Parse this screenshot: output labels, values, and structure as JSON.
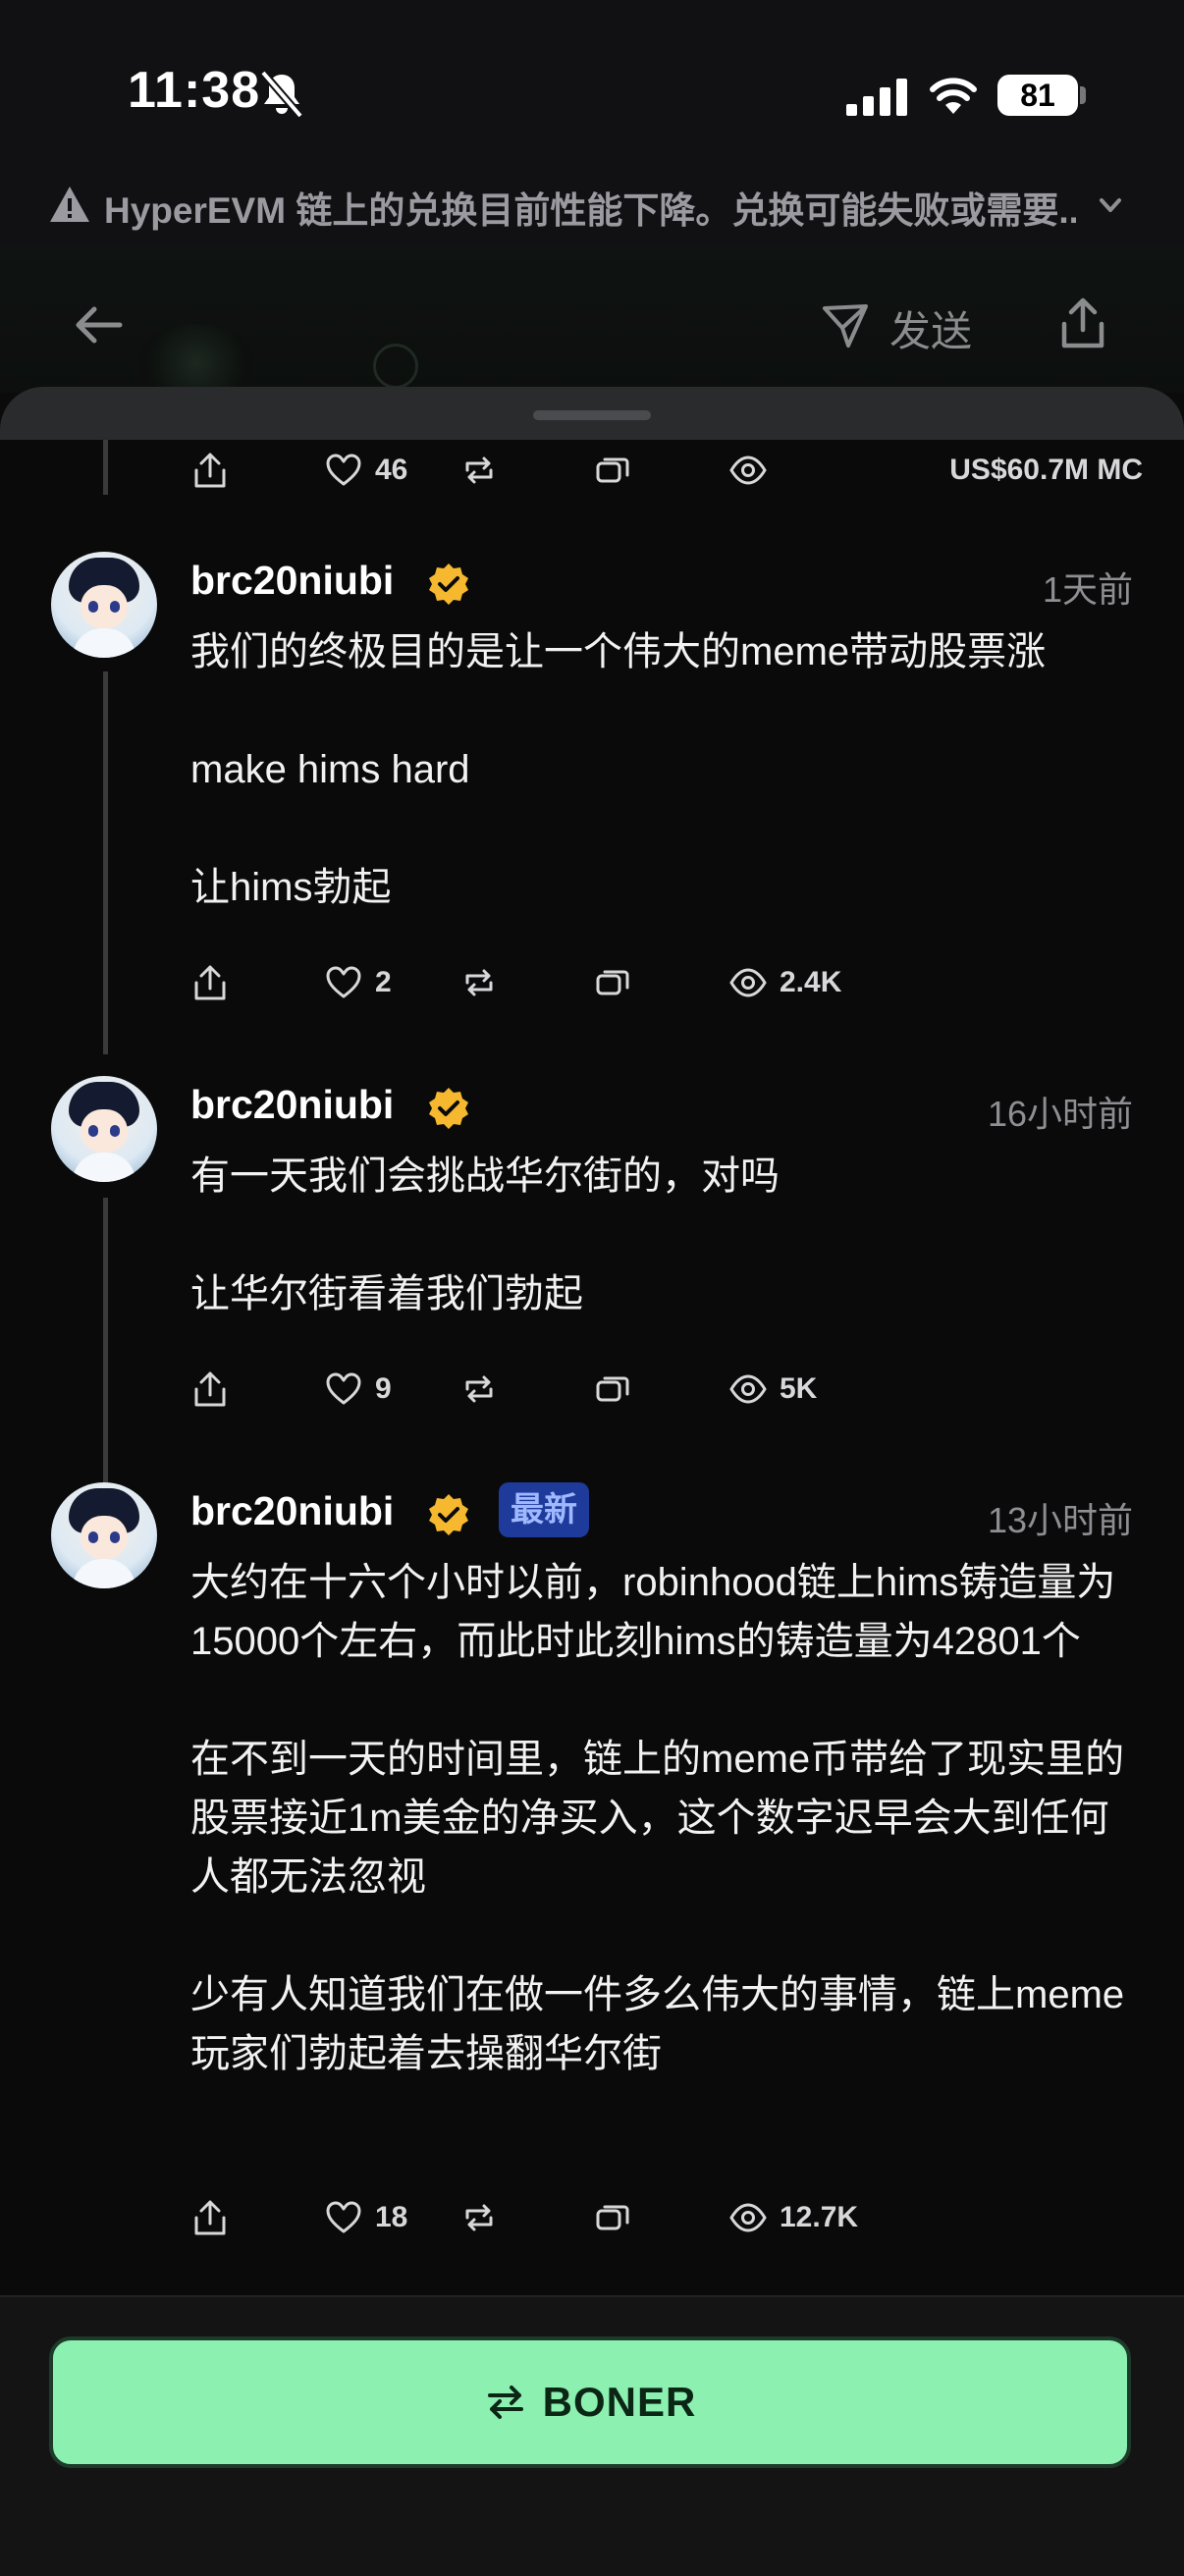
{
  "status_bar": {
    "time": "11:38",
    "battery": "81"
  },
  "warning": {
    "text": "HyperEVM 链上的兑换目前性能下降。兑换可能失败或需要..."
  },
  "header": {
    "send_label": "发送"
  },
  "top_actions": {
    "likes": "46",
    "market_cap": "US$60.7M MC"
  },
  "posts": [
    {
      "username": "brc20niubi",
      "time": "1天前",
      "paragraphs": [
        "我们的终极目的是让一个伟大的meme带动股票涨",
        "make hims hard",
        "让hims勃起"
      ],
      "likes": "2",
      "views": "2.4K"
    },
    {
      "username": "brc20niubi",
      "time": "16小时前",
      "paragraphs": [
        "有一天我们会挑战华尔街的，对吗",
        "让华尔街看着我们勃起"
      ],
      "likes": "9",
      "views": "5K"
    },
    {
      "username": "brc20niubi",
      "tag": "最新",
      "time": "13小时前",
      "paragraphs": [
        "大约在十六个小时以前，robinhood链上hims铸造量为15000个左右，而此时此刻hims的铸造量为42801个",
        "在不到一天的时间里，链上的meme币带给了现实里的股票接近1m美金的净买入，这个数字迟早会大到任何人都无法忽视",
        "少有人知道我们在做一件多么伟大的事情，链上meme玩家们勃起着去操翻华尔街"
      ],
      "likes": "18",
      "views": "12.7K"
    }
  ],
  "bottom": {
    "button_label": "BONER"
  },
  "colors": {
    "accent": "#8cf0b0",
    "verified": "#f5b82e",
    "tag_bg": "#1e3a9a"
  },
  "icons": [
    "bell-slash-icon",
    "signal-icon",
    "wifi-icon",
    "warning-icon",
    "chevron-down-icon",
    "back-arrow-icon",
    "send-icon",
    "share-icon",
    "like-icon",
    "repost-icon",
    "quote-icon",
    "views-icon",
    "verified-icon",
    "swap-icon"
  ]
}
